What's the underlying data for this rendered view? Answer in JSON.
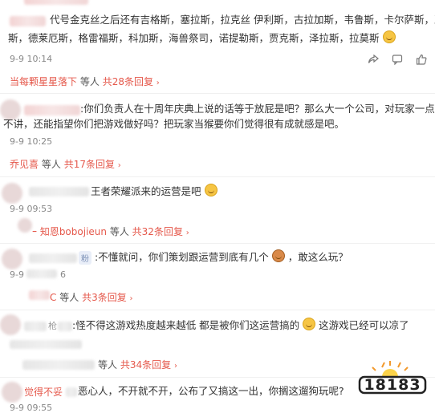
{
  "comments": [
    {
      "text_line1": "代号金克丝之后还有吉格斯，塞拉斯，拉克丝 伊利斯，古拉加斯，韦鲁斯，卡尔萨斯，亚",
      "text_line2": "斯，德莱厄斯，格雷福斯，科加斯，海兽祭司，诺提勒斯，贾克斯，泽拉斯，拉莫斯",
      "time": "9-9 10:14",
      "reply_user": "当每颗星星落下",
      "reply_others": "等人",
      "reply_count": "共28条回复"
    },
    {
      "text_line1": ":你们负责人在十周年庆典上说的话等于放屁是吧？那么大一个公司，对玩家一点诚信",
      "text_line2": "不讲，还能指望你们把游戏做好吗？把玩家当猴要你们觉得很有成就感是吧。",
      "time": "9-9 10:25",
      "reply_user": "乔见喜",
      "reply_others": "等人",
      "reply_count": "共17条回复"
    },
    {
      "text_line1": "王者荣耀派来的运营是吧",
      "time": "9-9 09:53",
      "reply_user": "ｰ 知恩bobojieun",
      "reply_others": "等人",
      "reply_count": "共32条回复"
    },
    {
      "badge": "粉",
      "text_line1": ":不懂就问，你们策划跟运营到底有几个",
      "text_line1_tail": "，敢这么玩？",
      "time": "9-9",
      "time_tail": "6",
      "reply_user": "C",
      "reply_others": "等人",
      "reply_count": "共3条回复"
    },
    {
      "text_prefix": "枪",
      "text_line1": ":怪不得这游戏热度越来越低 都是被你们这运营搞的",
      "text_line1_tail": "这游戏已经可以凉了",
      "reply_others": "等人",
      "reply_count": "共34条回复"
    },
    {
      "text_user": "觉得不妥",
      "text_line1": "恶心人，不开就不开，公布了又搞这一出，你搁这遛狗玩呢?",
      "time": "9-9 09:55"
    }
  ],
  "logo_text": "18183",
  "icons": [
    "share-icon",
    "comment-icon",
    "like-icon"
  ]
}
